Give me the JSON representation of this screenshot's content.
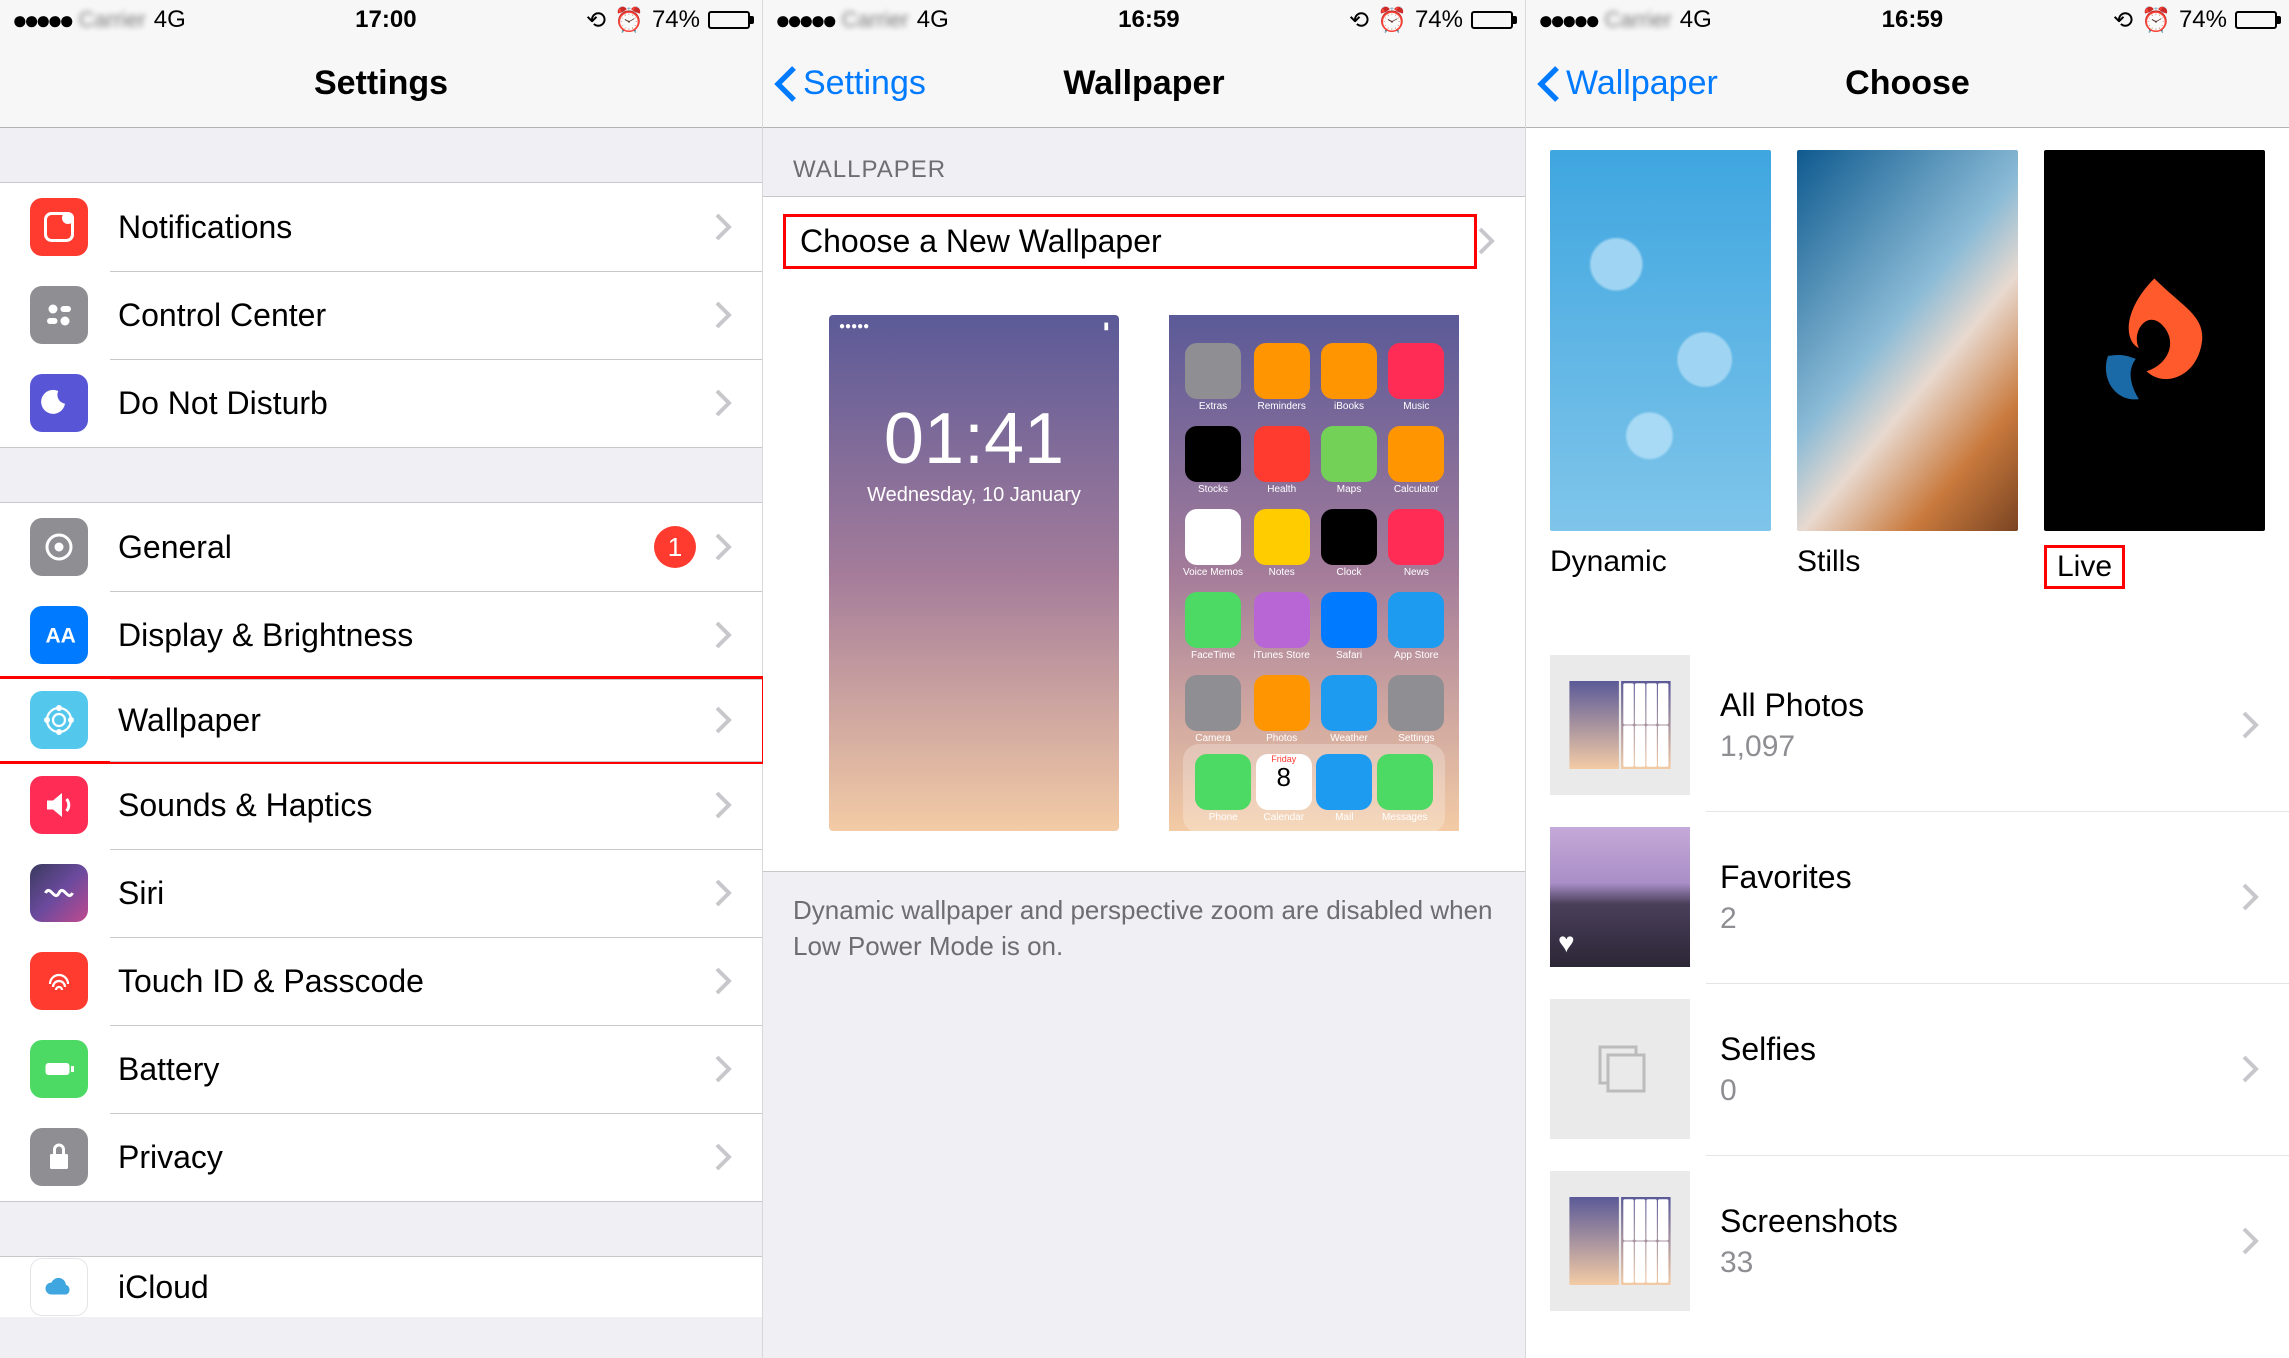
{
  "status": {
    "signal": "●●●●●",
    "carrier": "Carrier",
    "network": "4G",
    "battery_pct": "74%",
    "lock_glyph": "⟲",
    "alarm_glyph": "⏰"
  },
  "screen1": {
    "time": "17:00",
    "title": "Settings",
    "group1": [
      {
        "label": "Notifications",
        "icon": "notifications",
        "color": "#ff3b30"
      },
      {
        "label": "Control Center",
        "icon": "control-center",
        "color": "#8e8e93"
      },
      {
        "label": "Do Not Disturb",
        "icon": "dnd",
        "color": "#5856d6"
      }
    ],
    "group2": [
      {
        "label": "General",
        "icon": "general",
        "color": "#8e8e93",
        "badge": "1"
      },
      {
        "label": "Display & Brightness",
        "icon": "display",
        "color": "#007aff"
      },
      {
        "label": "Wallpaper",
        "icon": "wallpaper",
        "color": "#54c7ec",
        "highlight": true
      },
      {
        "label": "Sounds & Haptics",
        "icon": "sounds",
        "color": "#ff2d55"
      },
      {
        "label": "Siri",
        "icon": "siri",
        "color": "gradient"
      },
      {
        "label": "Touch ID & Passcode",
        "icon": "touchid",
        "color": "#ff3b30"
      },
      {
        "label": "Battery",
        "icon": "battery",
        "color": "#4cd964"
      },
      {
        "label": "Privacy",
        "icon": "privacy",
        "color": "#8e8e93"
      }
    ],
    "group3": [
      {
        "label": "iCloud",
        "icon": "icloud",
        "color": "#ffffff"
      }
    ]
  },
  "screen2": {
    "time": "16:59",
    "back": "Settings",
    "title": "Wallpaper",
    "section_header": "WALLPAPER",
    "choose_label": "Choose a New Wallpaper",
    "lock_preview": {
      "time": "01:41",
      "date": "Wednesday, 10 January"
    },
    "home_preview_apps": [
      "Extras",
      "Reminders",
      "iBooks",
      "Music",
      "Stocks",
      "Health",
      "Maps",
      "Calculator",
      "Voice Memos",
      "Notes",
      "Clock",
      "News",
      "FaceTime",
      "iTunes Store",
      "Safari",
      "App Store",
      "Camera",
      "Photos",
      "Weather",
      "Settings"
    ],
    "dock_apps": [
      "Phone",
      "Calendar",
      "Mail",
      "Messages"
    ],
    "calendar_day": "8",
    "calendar_dow": "Friday",
    "footnote": "Dynamic wallpaper and perspective zoom are disabled when Low Power Mode is on."
  },
  "screen3": {
    "time": "16:59",
    "back": "Wallpaper",
    "title": "Choose",
    "categories": [
      {
        "label": "Dynamic"
      },
      {
        "label": "Stills"
      },
      {
        "label": "Live",
        "highlight": true
      }
    ],
    "albums": [
      {
        "title": "All Photos",
        "count": "1,097",
        "thumb": "screenshot"
      },
      {
        "title": "Favorites",
        "count": "2",
        "thumb": "mountain",
        "heart": true
      },
      {
        "title": "Selfies",
        "count": "0",
        "thumb": "empty"
      },
      {
        "title": "Screenshots",
        "count": "33",
        "thumb": "screenshot"
      }
    ]
  }
}
